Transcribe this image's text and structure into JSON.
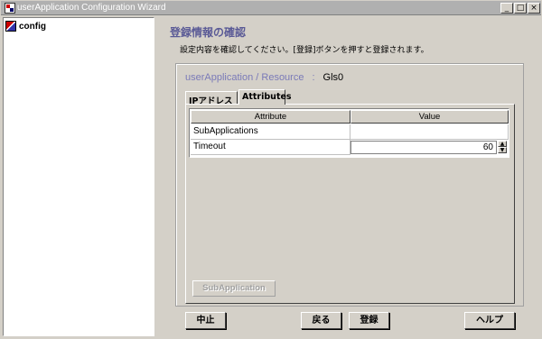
{
  "window": {
    "title": "userApplication Configuration Wizard"
  },
  "titlebar_buttons": {
    "minimize": "_",
    "maximize": "□",
    "close": "×"
  },
  "tree": {
    "root_label": "config"
  },
  "page": {
    "heading": "登録情報の確認",
    "description": "設定内容を確認してください。[登録]ボタンを押すと登録されます。",
    "resource_type": "userApplication / Resource",
    "resource_sep": ":",
    "resource_value": "Gls0"
  },
  "tabs": [
    {
      "label": "IPアドレス",
      "selected": false
    },
    {
      "label": "Attributes",
      "selected": true
    }
  ],
  "table": {
    "headers": [
      "Attribute",
      "Value"
    ],
    "rows": [
      {
        "attribute": "SubApplications",
        "value": ""
      },
      {
        "attribute": "Timeout",
        "value": "60"
      }
    ]
  },
  "subapplication_button": {
    "label": "SubApplication",
    "enabled": false
  },
  "buttons": {
    "cancel": "中止",
    "back": "戻る",
    "register": "登録",
    "help": "ヘルプ"
  },
  "colors": {
    "heading": "#5a5a96",
    "resource_label": "#7a7ab8",
    "background": "#d4d0c8"
  }
}
